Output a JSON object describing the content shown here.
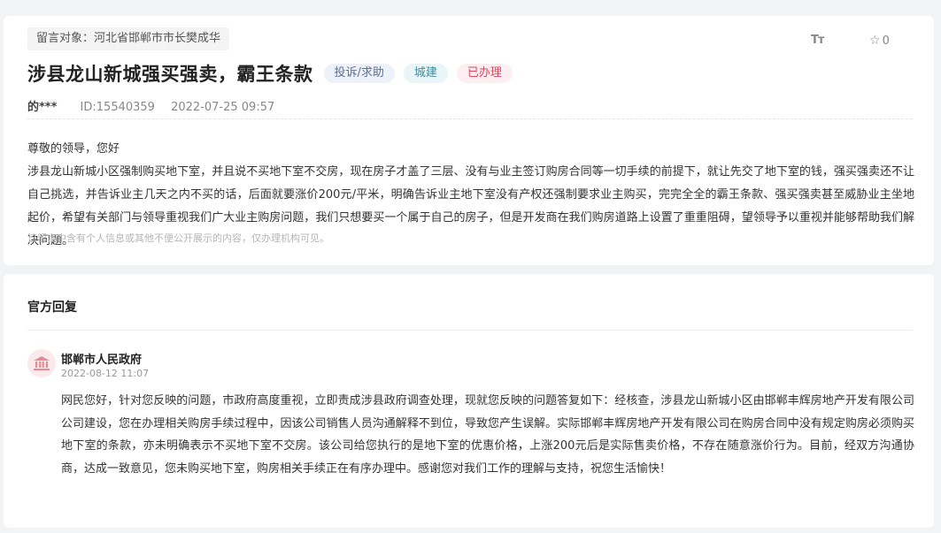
{
  "message": {
    "target_label": "留言对象：河北省邯郸市市长樊成华",
    "font_size_label": "Tт",
    "favorite_count": "0",
    "title": "涉县龙山新城强买强卖，霸王条款",
    "tags": {
      "category": "投诉/求助",
      "department": "城建",
      "status": "已办理"
    },
    "author": "的***",
    "id": "ID:15540359",
    "datetime": "2022-07-25 09:57",
    "greeting": "尊敬的领导，您好",
    "content": "涉县龙山新城小区强制购买地下室，并且说不买地下室不交房，现在房子才盖了三层、没有与业主签订购房合同等一切手续的前提下，就让先交了地下室的钱，强买强卖还不让自己挑选，并告诉业主几天之内不买的话，后面就要涨价200元/平米，明确告诉业主地下室没有产权还强制要求业主购买，完完全全的霸王条款、强买强卖甚至威胁业主坐地起价，希望有关部门与领导重视我们广大业主购房问题，我们只想要买一个属于自己的房子，但是开发商在我们购房道路上设置了重重阻碍，望领导予以重视并能够帮助我们解决问题。",
    "privacy_note": "该留言中含有个人信息或其他不便公开展示的内容，仅办理机构可见。"
  },
  "reply": {
    "header": "官方回复",
    "department": "邯郸市人民政府",
    "datetime": "2022-08-12 11:07",
    "content": "网民您好，针对您反映的问题，市政府高度重视，立即责成涉县政府调查处理，现就您反映的问题答复如下：经核查，涉县龙山新城小区由邯郸丰辉房地产开发有限公司公司建设，您在办理相关购房手续过程中，因该公司销售人员沟通解释不到位，导致您产生误解。实际邯郸丰辉房地产开发有限公司在购房合同中没有规定购房必须购买地下室的条款，亦未明确表示不买地下室不交房。该公司给您执行的是地下室的优惠价格，上涨200元后是实际售卖价格，不存在随意涨价行为。目前，经双方沟通协商，达成一致意见，您未购买地下室，购房相关手续正在有序办理中。感谢您对我们工作的理解与支持，祝您生活愉快！"
  }
}
